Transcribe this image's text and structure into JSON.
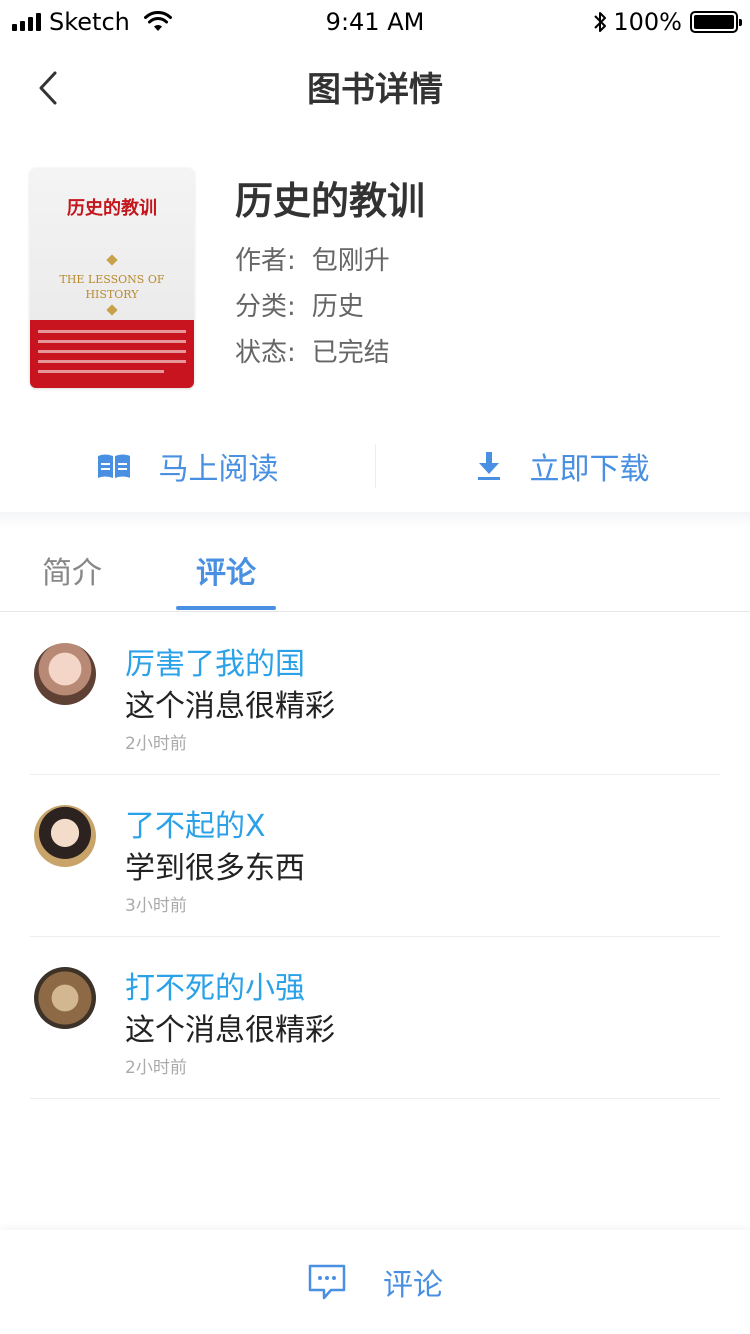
{
  "status_bar": {
    "carrier": "Sketch",
    "time": "9:41 AM",
    "battery": "100%"
  },
  "nav": {
    "title": "图书详情",
    "back_icon": "chevron-left-icon"
  },
  "book": {
    "title": "历史的教训",
    "author_label": "作者:",
    "author": "包刚升",
    "category_label": "分类:",
    "category": "历史",
    "status_label": "状态:",
    "status": "已完结",
    "cover": {
      "title": "历史的教训",
      "english_title_line1": "THE LESSONS OF",
      "english_title_line2": "HISTORY"
    }
  },
  "actions": {
    "read_label": "马上阅读",
    "read_icon": "open-book-icon",
    "download_label": "立即下载",
    "download_icon": "download-icon"
  },
  "tabs": [
    {
      "label": "简介",
      "active": false
    },
    {
      "label": "评论",
      "active": true
    }
  ],
  "comments": [
    {
      "user": "厉害了我的国",
      "text": "这个消息很精彩",
      "time": "2小时前"
    },
    {
      "user": "了不起的X",
      "text": "学到很多东西",
      "time": "3小时前"
    },
    {
      "user": "打不死的小强",
      "text": "这个消息很精彩",
      "time": "2小时前"
    }
  ],
  "bottom_bar": {
    "comment_label": "评论",
    "comment_icon": "speech-bubble-icon"
  },
  "colors": {
    "accent": "#4a90e2",
    "username": "#2ba1e8",
    "cover_red": "#c8141e"
  }
}
